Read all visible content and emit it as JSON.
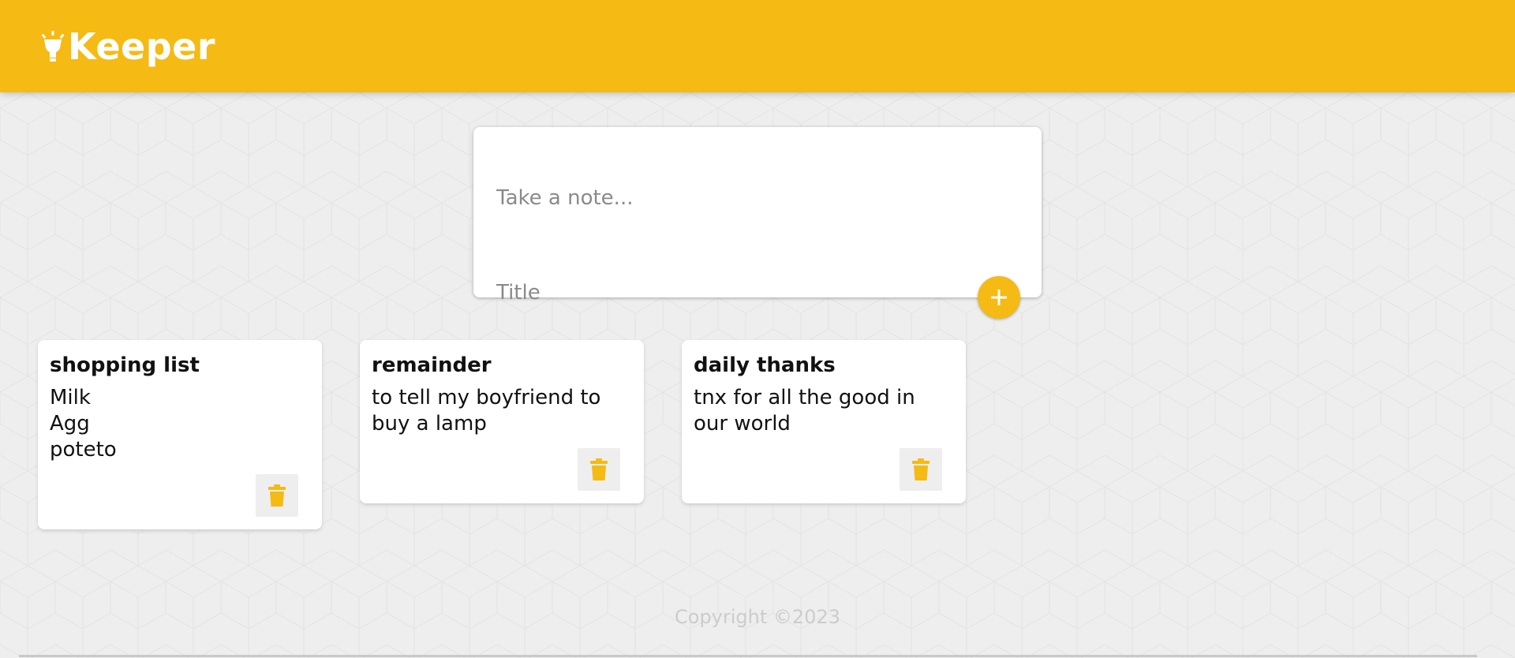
{
  "header": {
    "app_name": "Keeper",
    "logo_icon": "lightbulb-icon",
    "brand_color": "#f5ba13"
  },
  "composer": {
    "title_placeholder": "Title",
    "title_value": "",
    "note_placeholder": "Take a note...",
    "note_value": "",
    "add_icon": "plus-icon"
  },
  "notes": [
    {
      "title": "shopping list",
      "content": "Milk\nAgg\npoteto",
      "delete_icon": "trash-icon"
    },
    {
      "title": "remainder",
      "content": "to tell my boyfriend to\nbuy a lamp",
      "delete_icon": "trash-icon"
    },
    {
      "title": "daily thanks",
      "content": "tnx for all the good in\nour world",
      "delete_icon": "trash-icon"
    }
  ],
  "footer": {
    "copyright": "Copyright ©2023"
  },
  "colors": {
    "background": "#eeeeee",
    "accent": "#f5ba13",
    "card": "#ffffff",
    "footer_text": "#cccccc"
  }
}
